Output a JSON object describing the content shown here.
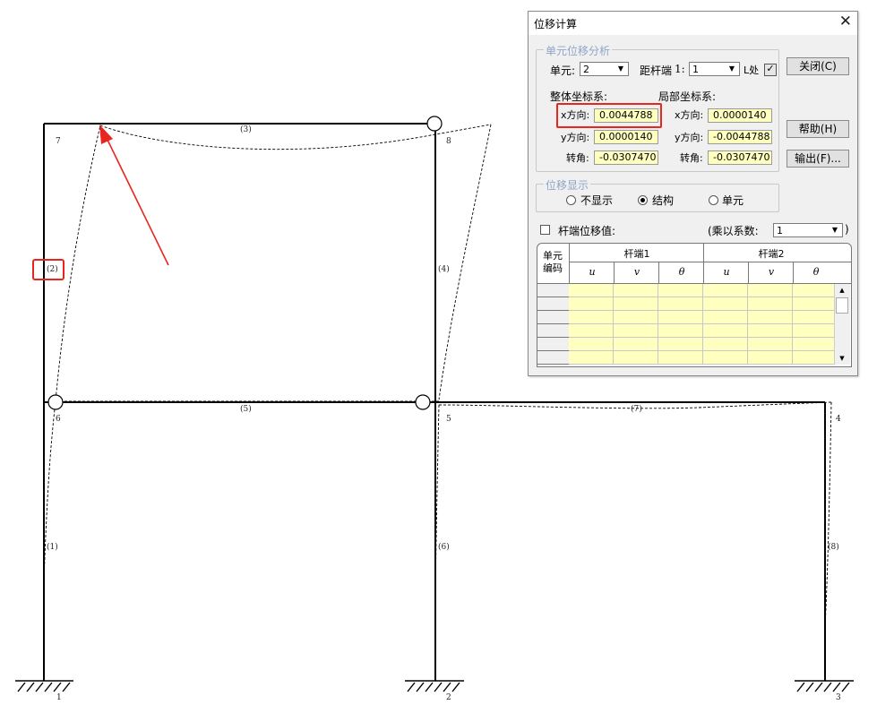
{
  "structure": {
    "node_labels": [
      "1",
      "2",
      "3",
      "4",
      "5",
      "6",
      "7",
      "8"
    ],
    "member_labels": [
      "(1)",
      "(2)",
      "(3)",
      "(4)",
      "(5)",
      "(6)",
      "(7)",
      "(8)"
    ]
  },
  "dialog": {
    "title": "位移计算",
    "close_glyph": "✕",
    "analysis_group": "单元位移分析",
    "element_label": "单元:",
    "element_value": "2",
    "distance_label": "距杆端",
    "distance_end": "1:",
    "distance_value": "1",
    "l_label": "L处",
    "global_label": "整体坐标系:",
    "local_label": "局部坐标系:",
    "x_dir": "x方向:",
    "y_dir": "y方向:",
    "rotation": "转角:",
    "global_x": "0.0044788",
    "global_y": "0.0000140",
    "global_rot": "-0.0307470",
    "local_x": "0.0000140",
    "local_y": "-0.0044788",
    "local_rot": "-0.0307470",
    "close_button": "关闭(C)",
    "help_button": "帮助(H)",
    "export_button": "输出(F)...",
    "display_group": "位移显示",
    "radio_hide": "不显示",
    "radio_structure": "结构",
    "radio_element": "单元",
    "end_disp_label": "杆端位移值:",
    "multiply_label": "(乘以系数:",
    "multiply_value": "1",
    "multiply_close": ")",
    "table": {
      "col_element": "单元",
      "col_code": "编码",
      "end1": "杆端1",
      "end2": "杆端2",
      "u": "u",
      "v": "v",
      "theta": "θ"
    },
    "arrow_up": "▲",
    "arrow_down": "▼",
    "combo_arrow": "▼",
    "check_mark": "✓"
  },
  "colors": {
    "annotation_red": "#e8261e",
    "field_yellow": "#ffffc0",
    "group_title_blue": "#8ea5c8"
  }
}
